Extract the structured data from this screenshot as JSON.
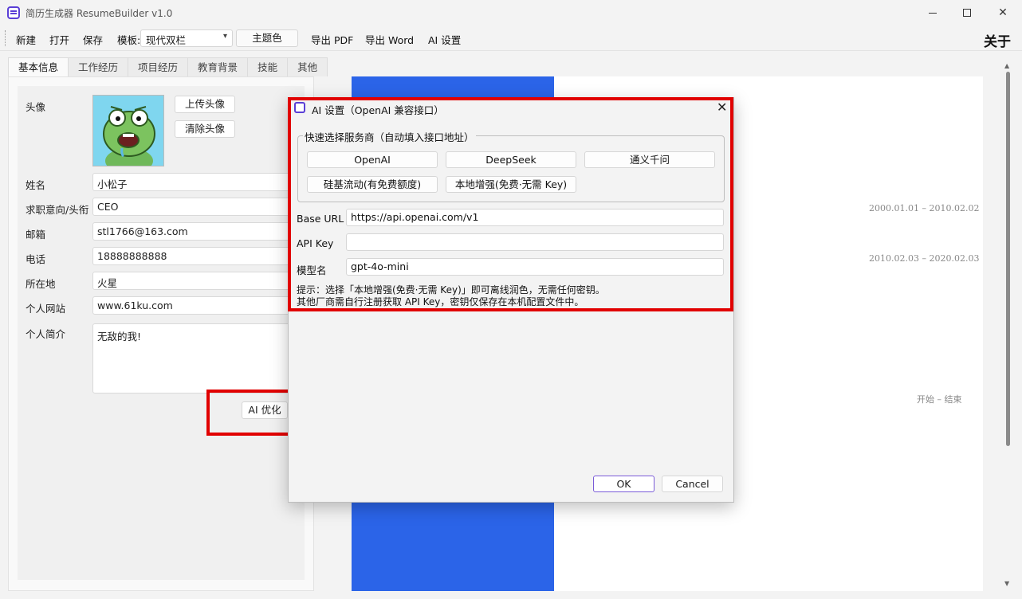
{
  "window": {
    "title": "简历生成器 ResumeBuilder  v1.0"
  },
  "toolbar": {
    "new": "新建",
    "open": "打开",
    "save": "保存",
    "template_label": "模板:",
    "template_value": "现代双栏",
    "theme_color": "主题色",
    "export_pdf": "导出 PDF",
    "export_word": "导出 Word",
    "ai_settings": "AI 设置",
    "about": "关于"
  },
  "tabs": [
    {
      "label": "基本信息"
    },
    {
      "label": "工作经历"
    },
    {
      "label": "项目经历"
    },
    {
      "label": "教育背景"
    },
    {
      "label": "技能"
    },
    {
      "label": "其他"
    }
  ],
  "form": {
    "avatar_label": "头像",
    "upload_avatar": "上传头像",
    "clear_avatar": "清除头像",
    "name_label": "姓名",
    "name_value": "小松子",
    "title_label": "求职意向/头衔",
    "title_value": "CEO",
    "email_label": "邮箱",
    "email_value": "stl1766@163.com",
    "phone_label": "电话",
    "phone_value": "18888888888",
    "location_label": "所在地",
    "location_value": "火星",
    "website_label": "个人网站",
    "website_value": "www.61ku.com",
    "bio_label": "个人简介",
    "bio_value": "无敌的我!",
    "ai_optimize": "AI 优化"
  },
  "preview": {
    "date1": "2000.01.01 – 2010.02.02",
    "date2": "2010.02.03 – 2020.02.03",
    "date3": "开始 – 结束",
    "side_color": "#2b64e8"
  },
  "dialog": {
    "title": "AI 设置（OpenAI 兼容接口）",
    "group_title": "快速选择服务商（自动填入接口地址）",
    "providers": [
      "OpenAI",
      "DeepSeek",
      "通义千问",
      "硅基流动(有免费额度)",
      "本地增强(免费·无需 Key)"
    ],
    "base_url_label": "Base URL",
    "base_url_value": "https://api.openai.com/v1",
    "api_key_label": "API Key",
    "api_key_value": "",
    "model_label": "模型名",
    "model_value": "gpt-4o-mini",
    "hint1": "提示：选择「本地增强(免费·无需 Key)」即可离线润色，无需任何密钥。",
    "hint2": "其他厂商需自行注册获取 API Key，密钥仅保存在本机配置文件中。",
    "ok": "OK",
    "cancel": "Cancel"
  },
  "colors": {
    "accent": "#5a3fd6",
    "highlight": "#e10000"
  }
}
